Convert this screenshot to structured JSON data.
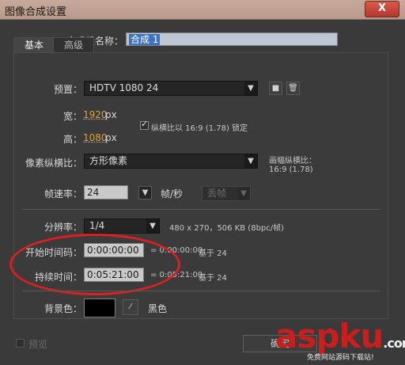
{
  "window": {
    "title": "图像合成设置",
    "close": "X"
  },
  "composition": {
    "name_label": "合成组名称：",
    "name_value": "合成 1"
  },
  "tabs": [
    {
      "label": "基本"
    },
    {
      "label": "高级"
    }
  ],
  "preset": {
    "label": "预置：",
    "value": "HDTV 1080 24"
  },
  "size": {
    "width_label": "宽：",
    "width_value": "1920",
    "height_label": "高：",
    "height_value": "1080",
    "unit": "px",
    "lock_text": "纵横比以 16:9 (1.78) 锁定",
    "lock_checked": true
  },
  "pixel_aspect": {
    "label": "像素纵横比：",
    "value": "方形像素",
    "frame_aspect_label": "画幅纵横比：",
    "frame_aspect_value": "16:9 (1.78)"
  },
  "frame_rate": {
    "label": "帧速率：",
    "value": "24",
    "unit": "帧/秒",
    "drop_frame": "丢帧"
  },
  "resolution": {
    "label": "分辨率：",
    "value": "1/4",
    "info": "480 x 270，506 KB (8bpc/帧)"
  },
  "timecode": {
    "start_label": "开始时间码：",
    "start_value": "0:00:00:00",
    "start_info": "= 0:00:00:00",
    "start_base": "基于 24",
    "duration_label": "持续时间：",
    "duration_value": "0:05:21:00",
    "duration_info": "= 0:05:21:00",
    "duration_base": "基于 24"
  },
  "background": {
    "label": "背景色：",
    "name": "黑色",
    "color": "#000000"
  },
  "preview_label": "预览",
  "ok_label": "确定",
  "watermark": {
    "brand": "aspku",
    "domain": ".com",
    "sub": "免费网站源码下载站!"
  },
  "colors": {
    "annotation": "#d82121",
    "accent": "#e0a13c"
  }
}
